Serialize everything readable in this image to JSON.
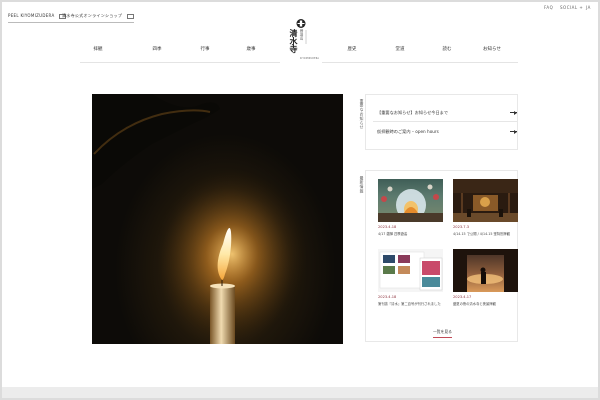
{
  "header": {
    "link_peel": "PEEL KIYOMIZUDERA",
    "link_shop": "清水寺公式オンラインショップ",
    "util_fag": "FAQ",
    "util_social": "SOCIAL +",
    "util_lang": "JA",
    "logo_top": "音羽山",
    "logo_main": "清水寺",
    "logo_sub": "KIYOMIZUDERA"
  },
  "nav": {
    "items": [
      "拝観",
      "四季",
      "行事",
      "歳事",
      "歴史",
      "堂道",
      "読む",
      "お知らせ"
    ]
  },
  "notices": {
    "label": "重要なお知らせ",
    "items": [
      "【重要なお知らせ】お知らせ今日まで",
      "仮拝観時のご案内 – open hours"
    ]
  },
  "news": {
    "label": "最新情報",
    "items": [
      {
        "date": "2023.4.18",
        "title": "4/17 雑禅 四季遊善"
      },
      {
        "date": "2023.7.3",
        "title": "4/14.15 で公開 / 4/14.15 堂特別拝観"
      },
      {
        "date": "2023.4.18",
        "title": "第刊誌『清水』第二百号が刊行されました"
      },
      {
        "date": "2023.4.17",
        "title": "盛夏の夜の清水寺と夜景拝観"
      }
    ],
    "more_label": "一覧を見る"
  },
  "colors": {
    "accent": "#8b2f3a",
    "more_underline": "#c14a57",
    "background": "#ffffff"
  },
  "icons": [
    "external-link-icon",
    "logo-seal-icon",
    "arrow-right-icon"
  ]
}
